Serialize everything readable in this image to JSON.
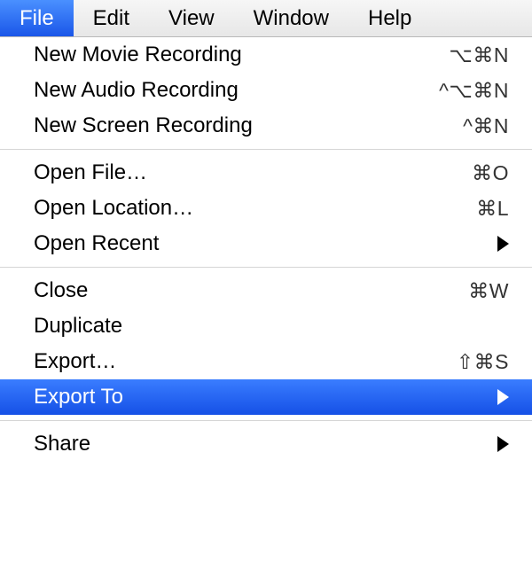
{
  "menubar": {
    "items": [
      {
        "label": "File",
        "active": true
      },
      {
        "label": "Edit",
        "active": false
      },
      {
        "label": "View",
        "active": false
      },
      {
        "label": "Window",
        "active": false
      },
      {
        "label": "Help",
        "active": false
      }
    ]
  },
  "menu": {
    "groups": [
      [
        {
          "label": "New Movie Recording",
          "shortcut": "⌥⌘N",
          "submenu": false
        },
        {
          "label": "New Audio Recording",
          "shortcut": "^⌥⌘N",
          "submenu": false
        },
        {
          "label": "New Screen Recording",
          "shortcut": "^⌘N",
          "submenu": false
        }
      ],
      [
        {
          "label": "Open File…",
          "shortcut": "⌘O",
          "submenu": false
        },
        {
          "label": "Open Location…",
          "shortcut": "⌘L",
          "submenu": false
        },
        {
          "label": "Open Recent",
          "shortcut": "",
          "submenu": true
        }
      ],
      [
        {
          "label": "Close",
          "shortcut": "⌘W",
          "submenu": false
        },
        {
          "label": "Duplicate",
          "shortcut": "",
          "submenu": false
        },
        {
          "label": "Export…",
          "shortcut": "⇧⌘S",
          "submenu": false
        },
        {
          "label": "Export To",
          "shortcut": "",
          "submenu": true,
          "highlighted": true
        }
      ],
      [
        {
          "label": "Share",
          "shortcut": "",
          "submenu": true
        }
      ]
    ]
  }
}
